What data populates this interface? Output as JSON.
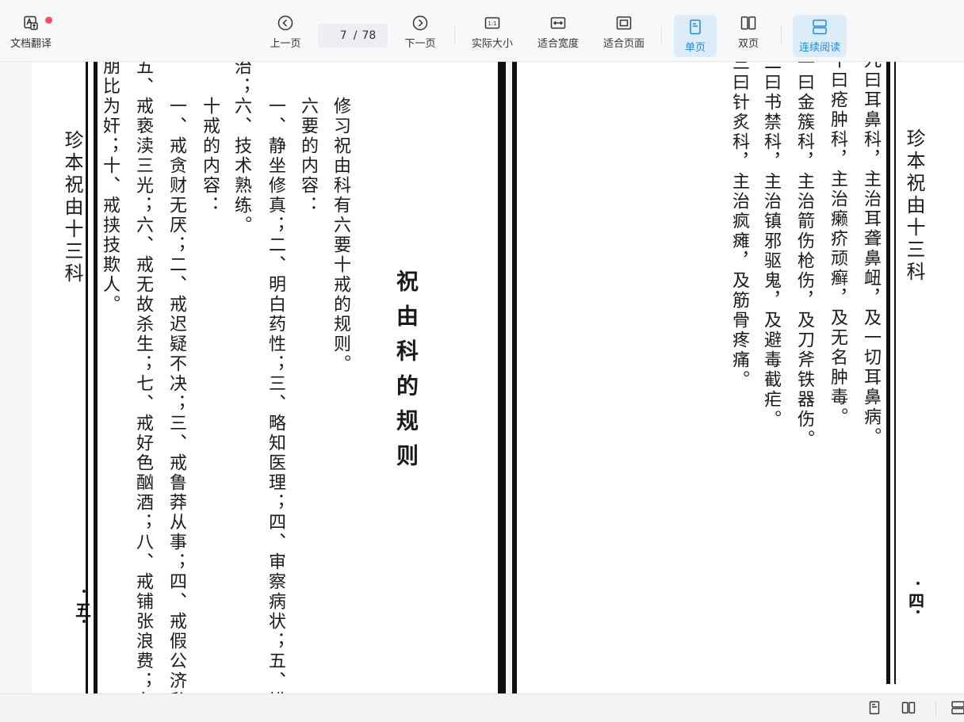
{
  "toolbar": {
    "translate": {
      "label": "文档翻译",
      "icon": "doc-translate-icon"
    },
    "prev": {
      "label": "上一页",
      "icon": "chevron-left-circle-icon"
    },
    "page": {
      "current": "7",
      "separator": "/",
      "total": "78"
    },
    "next": {
      "label": "下一页",
      "icon": "chevron-right-circle-icon"
    },
    "actual_size": {
      "label": "实际大小",
      "icon": "actual-size-icon",
      "glyph": "1:1"
    },
    "fit_width": {
      "label": "适合宽度",
      "icon": "fit-width-icon"
    },
    "fit_page": {
      "label": "适合页面",
      "icon": "fit-page-icon"
    },
    "single_page": {
      "label": "单页",
      "icon": "single-page-icon",
      "active": true
    },
    "double_page": {
      "label": "双页",
      "icon": "double-page-icon"
    },
    "continuous": {
      "label": "连续阅读",
      "icon": "continuous-read-icon",
      "active": true
    },
    "accent_color": "#1e8bd6",
    "active_bg": "#dcedf9",
    "notify_dot_color": "#ff4d6a"
  },
  "left_page": {
    "running_head": "珍本祝由十三科",
    "page_number": "五",
    "chapter_title": "祝由科的规则",
    "lines": [
      "修习祝由科有六要十戒的规则。",
      "六要的内容：",
      "一、静坐修真；二、明白药性；三、略知医理；四、审察病状；五、辨证施",
      "治；六、技术熟练。",
      "十戒的内容：",
      "一、戒贪财无厌；二、戒迟疑不决；三、戒鲁莽从事；四、戒假公济私；",
      "五、戒亵渎三光；六、戒无故杀生；七、戒好色酗酒；八、戒铺张浪费；九、戒",
      "朋比为奸；十、戒挟技欺人。"
    ]
  },
  "right_page": {
    "running_head": "珍本祝由十三科",
    "page_number": "四",
    "lines": [
      "九曰耳鼻科，主治耳聋鼻衄，及一切耳鼻病。",
      "十曰疮肿科，主治癞疥顽癣，及无名肿毒。",
      "十一曰金簇科，主治箭伤枪伤，及刀斧铁器伤。",
      "十二曰书禁科，主治镇邪驱鬼，及避毒截疟。",
      "十三曰针炙科，主治疯瘫，及筋骨疼痛。"
    ]
  },
  "bottombar": {
    "icons": [
      "single-page-icon",
      "double-page-icon",
      "continuous-read-icon"
    ]
  }
}
